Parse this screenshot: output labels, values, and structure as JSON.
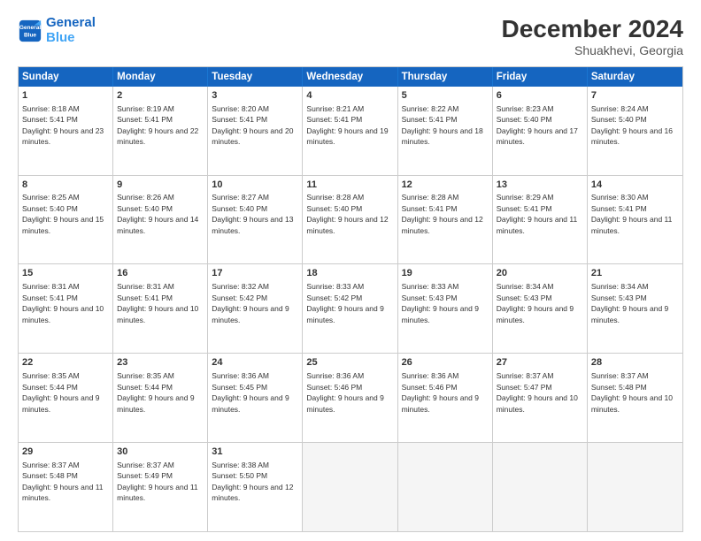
{
  "logo": {
    "line1": "General",
    "line2": "Blue"
  },
  "title": "December 2024",
  "subtitle": "Shuakhevi, Georgia",
  "header_days": [
    "Sunday",
    "Monday",
    "Tuesday",
    "Wednesday",
    "Thursday",
    "Friday",
    "Saturday"
  ],
  "weeks": [
    [
      {
        "day": "1",
        "rise": "8:18 AM",
        "set": "5:41 PM",
        "daylight": "9 hours and 23 minutes."
      },
      {
        "day": "2",
        "rise": "8:19 AM",
        "set": "5:41 PM",
        "daylight": "9 hours and 22 minutes."
      },
      {
        "day": "3",
        "rise": "8:20 AM",
        "set": "5:41 PM",
        "daylight": "9 hours and 20 minutes."
      },
      {
        "day": "4",
        "rise": "8:21 AM",
        "set": "5:41 PM",
        "daylight": "9 hours and 19 minutes."
      },
      {
        "day": "5",
        "rise": "8:22 AM",
        "set": "5:41 PM",
        "daylight": "9 hours and 18 minutes."
      },
      {
        "day": "6",
        "rise": "8:23 AM",
        "set": "5:40 PM",
        "daylight": "9 hours and 17 minutes."
      },
      {
        "day": "7",
        "rise": "8:24 AM",
        "set": "5:40 PM",
        "daylight": "9 hours and 16 minutes."
      }
    ],
    [
      {
        "day": "8",
        "rise": "8:25 AM",
        "set": "5:40 PM",
        "daylight": "9 hours and 15 minutes."
      },
      {
        "day": "9",
        "rise": "8:26 AM",
        "set": "5:40 PM",
        "daylight": "9 hours and 14 minutes."
      },
      {
        "day": "10",
        "rise": "8:27 AM",
        "set": "5:40 PM",
        "daylight": "9 hours and 13 minutes."
      },
      {
        "day": "11",
        "rise": "8:28 AM",
        "set": "5:40 PM",
        "daylight": "9 hours and 12 minutes."
      },
      {
        "day": "12",
        "rise": "8:28 AM",
        "set": "5:41 PM",
        "daylight": "9 hours and 12 minutes."
      },
      {
        "day": "13",
        "rise": "8:29 AM",
        "set": "5:41 PM",
        "daylight": "9 hours and 11 minutes."
      },
      {
        "day": "14",
        "rise": "8:30 AM",
        "set": "5:41 PM",
        "daylight": "9 hours and 11 minutes."
      }
    ],
    [
      {
        "day": "15",
        "rise": "8:31 AM",
        "set": "5:41 PM",
        "daylight": "9 hours and 10 minutes."
      },
      {
        "day": "16",
        "rise": "8:31 AM",
        "set": "5:41 PM",
        "daylight": "9 hours and 10 minutes."
      },
      {
        "day": "17",
        "rise": "8:32 AM",
        "set": "5:42 PM",
        "daylight": "9 hours and 9 minutes."
      },
      {
        "day": "18",
        "rise": "8:33 AM",
        "set": "5:42 PM",
        "daylight": "9 hours and 9 minutes."
      },
      {
        "day": "19",
        "rise": "8:33 AM",
        "set": "5:43 PM",
        "daylight": "9 hours and 9 minutes."
      },
      {
        "day": "20",
        "rise": "8:34 AM",
        "set": "5:43 PM",
        "daylight": "9 hours and 9 minutes."
      },
      {
        "day": "21",
        "rise": "8:34 AM",
        "set": "5:43 PM",
        "daylight": "9 hours and 9 minutes."
      }
    ],
    [
      {
        "day": "22",
        "rise": "8:35 AM",
        "set": "5:44 PM",
        "daylight": "9 hours and 9 minutes."
      },
      {
        "day": "23",
        "rise": "8:35 AM",
        "set": "5:44 PM",
        "daylight": "9 hours and 9 minutes."
      },
      {
        "day": "24",
        "rise": "8:36 AM",
        "set": "5:45 PM",
        "daylight": "9 hours and 9 minutes."
      },
      {
        "day": "25",
        "rise": "8:36 AM",
        "set": "5:46 PM",
        "daylight": "9 hours and 9 minutes."
      },
      {
        "day": "26",
        "rise": "8:36 AM",
        "set": "5:46 PM",
        "daylight": "9 hours and 9 minutes."
      },
      {
        "day": "27",
        "rise": "8:37 AM",
        "set": "5:47 PM",
        "daylight": "9 hours and 10 minutes."
      },
      {
        "day": "28",
        "rise": "8:37 AM",
        "set": "5:48 PM",
        "daylight": "9 hours and 10 minutes."
      }
    ],
    [
      {
        "day": "29",
        "rise": "8:37 AM",
        "set": "5:48 PM",
        "daylight": "9 hours and 11 minutes."
      },
      {
        "day": "30",
        "rise": "8:37 AM",
        "set": "5:49 PM",
        "daylight": "9 hours and 11 minutes."
      },
      {
        "day": "31",
        "rise": "8:38 AM",
        "set": "5:50 PM",
        "daylight": "9 hours and 12 minutes."
      },
      null,
      null,
      null,
      null
    ]
  ]
}
